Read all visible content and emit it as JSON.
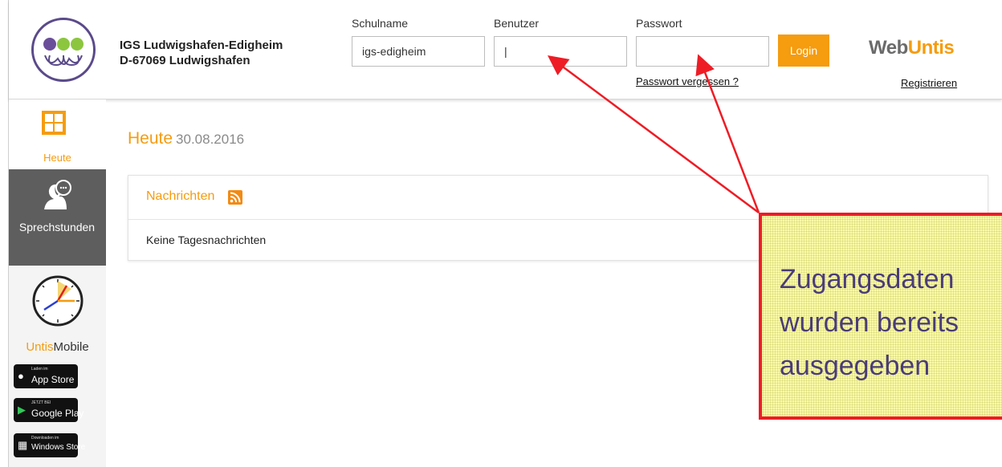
{
  "header": {
    "school_name": "IGS Ludwigshafen-Edigheim",
    "school_city": "D-67069 Ludwigshafen",
    "schoolname_label": "Schulname",
    "schoolname_value": "igs-edigheim",
    "user_label": "Benutzer",
    "user_value": "|",
    "password_label": "Passwort",
    "password_value": "",
    "login_label": "Login",
    "forgot_password": "Passwort vergessen ?",
    "register": "Registrieren",
    "brand_web": "Web",
    "brand_untis": "Untis"
  },
  "sidebar": {
    "today_label": "Heute",
    "consult_label": "Sprechstunden",
    "untis_part": "Untis",
    "mobile_part": "Mobile",
    "stores": [
      {
        "small": "Laden im",
        "big": "App Store",
        "icon": "apple-icon"
      },
      {
        "small": "JETZT BEI",
        "big": "Google Play",
        "icon": "google-play-icon"
      },
      {
        "small": "Downloaden im",
        "big": "Windows Store",
        "icon": "windows-store-icon"
      }
    ]
  },
  "main": {
    "title": "Heute",
    "date": "30.08.2016",
    "news_title": "Nachrichten",
    "news_empty": "Keine Tagesnachrichten"
  },
  "annotation": {
    "line1": "Zugangsdaten",
    "line2": "wurden bereits",
    "line3": "ausgegeben"
  },
  "colors": {
    "accent": "#f59c0f",
    "sidebar_active": "#5e5e5e",
    "callout_border": "#ee1c25",
    "callout_fill": "#fafaa8",
    "callout_text": "#4a3b78"
  }
}
